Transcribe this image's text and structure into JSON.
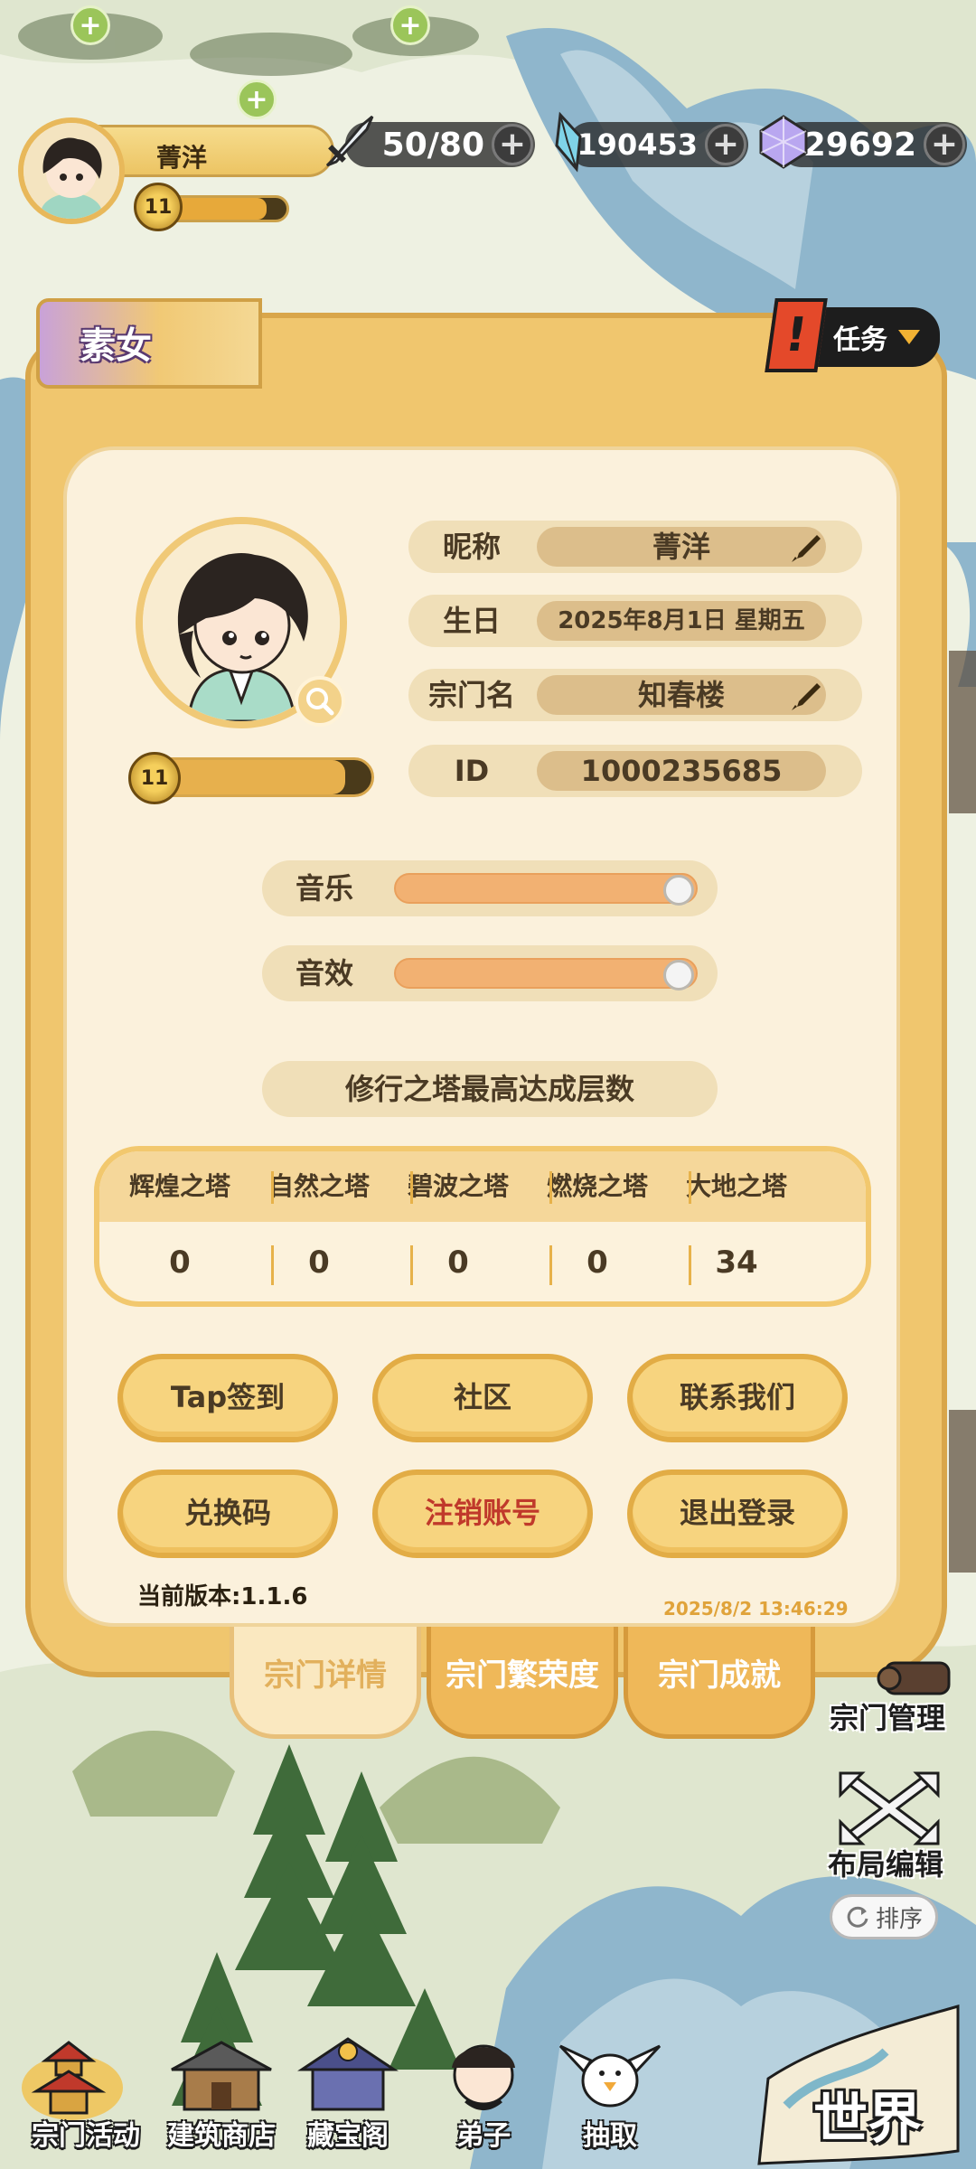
{
  "hud": {
    "player_name": "菁洋",
    "player_level": "11",
    "stamina": "50/80",
    "crystals": "190453",
    "gems": "29692",
    "plus": "+"
  },
  "character_tag": "素女",
  "task_button": {
    "label": "任务",
    "alert": "!"
  },
  "profile": {
    "level": "11",
    "rows": [
      {
        "label": "昵称",
        "value": "菁洋",
        "editable": true
      },
      {
        "label": "生日",
        "value": "2025年8月1日 星期五",
        "editable": false
      },
      {
        "label": "宗门名",
        "value": "知春楼",
        "editable": true
      },
      {
        "label": "ID",
        "value": "1000235685",
        "editable": false
      }
    ]
  },
  "settings": {
    "music": {
      "label": "音乐",
      "level": 1.0
    },
    "sound": {
      "label": "音效",
      "level": 1.0
    }
  },
  "tower": {
    "title": "修行之塔最高达成层数",
    "columns": [
      "辉煌之塔",
      "自然之塔",
      "碧波之塔",
      "燃烧之塔",
      "大地之塔"
    ],
    "values": [
      "0",
      "0",
      "0",
      "0",
      "34"
    ]
  },
  "buttons": {
    "checkin": "Tap签到",
    "community": "社区",
    "contact": "联系我们",
    "redeem": "兑换码",
    "delete_account": "注销账号",
    "logout": "退出登录"
  },
  "version": "当前版本:1.1.6",
  "timestamp": "2025/8/2 13:46:29",
  "panel_tabs": [
    "宗门详情",
    "宗门繁荣度",
    "宗门成就"
  ],
  "side_tools": {
    "manage": "宗门管理",
    "layout_edit": "布局编辑",
    "sort": "排序"
  },
  "bottom_nav": [
    "宗门活动",
    "建筑商店",
    "藏宝阁",
    "弟子",
    "抽取"
  ],
  "world": "世界",
  "colors": {
    "panel": "#f0c66e",
    "panel_inner": "#fbf1dc",
    "button": "#f7d47f",
    "danger_text": "#c0392b",
    "accent": "#e7b04d"
  }
}
